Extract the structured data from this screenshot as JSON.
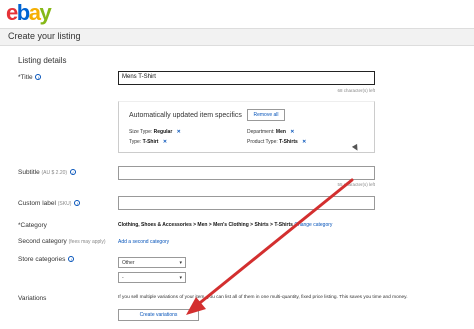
{
  "brand": {
    "l1": "e",
    "l2": "b",
    "l3": "a",
    "l4": "y"
  },
  "header": {
    "title": "Create your listing"
  },
  "section": {
    "title": "Listing details"
  },
  "title_field": {
    "label": "*Title",
    "value": "Mens T-Shirt",
    "counter": "68 character(s) left"
  },
  "specifics": {
    "title": "Automatically updated item specifics",
    "remove_label": "Remove all",
    "items": [
      {
        "name": "Size Type:",
        "value": "Regular"
      },
      {
        "name": "Department:",
        "value": "Men"
      },
      {
        "name": "Type:",
        "value": "T-Shirt"
      },
      {
        "name": "Product Type:",
        "value": "T-Shirts"
      }
    ],
    "remove_x": "✕"
  },
  "subtitle_field": {
    "label": "Subtitle",
    "hint": "(AU $ 2.20)",
    "value": "",
    "counter": "55 character(s) left"
  },
  "custom_label": {
    "label": "Custom label",
    "hint": "(SKU)",
    "value": ""
  },
  "category": {
    "label": "*Category",
    "path": "Clothing, Shoes & Accessories > Men > Men's Clothing > Shirts > T-Shirts",
    "change_link": "Change category"
  },
  "second_category": {
    "label": "Second category",
    "hint": "(fees may apply)",
    "link": "Add a second category"
  },
  "store_categories": {
    "label": "Store categories",
    "select1": "Other",
    "select2": "-"
  },
  "variations": {
    "label": "Variations",
    "text": "If you sell multiple variations of your item, you can list all of them in one multi-quantity, fixed price listing. This saves you time and money.",
    "button": "Create variations"
  },
  "colors": {
    "arrow": "#d32f2f",
    "link": "#0654ba"
  }
}
